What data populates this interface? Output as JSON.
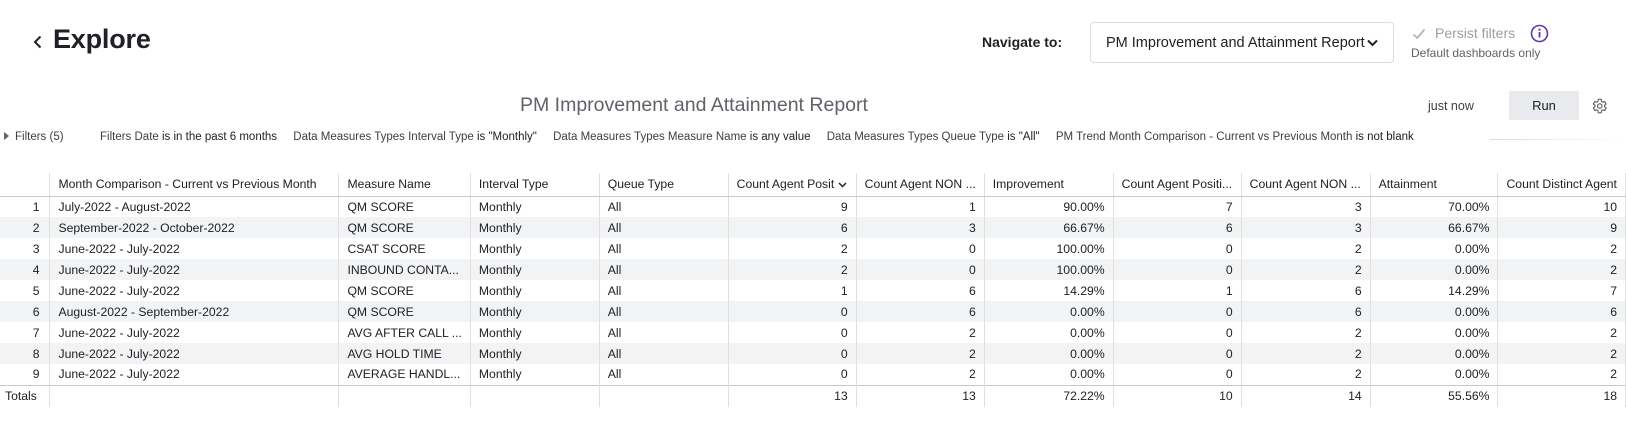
{
  "header": {
    "title": "Explore",
    "navigate_label": "Navigate to:",
    "navigate_value": "PM Improvement and Attainment Report",
    "persist_label": "Persist filters",
    "persist_sub": "Default dashboards only"
  },
  "report": {
    "title": "PM Improvement and Attainment Report",
    "last_run": "just now",
    "run_label": "Run"
  },
  "filters": {
    "toggle_label": "Filters (5)",
    "items": [
      {
        "prefix": "Filters Date",
        "op": " is in the past 6 months"
      },
      {
        "prefix": "Data Measures Types Interval Type",
        "op": " is \"Monthly\""
      },
      {
        "prefix": "Data Measures Types Measure Name",
        "op": " is any value"
      },
      {
        "prefix": "Data Measures Types Queue Type",
        "op": " is \"All\""
      },
      {
        "prefix": "PM Trend Month Comparison - Current vs Previous Month",
        "op": " is not blank"
      }
    ]
  },
  "table": {
    "headers": [
      "",
      "Month Comparison - Current vs Previous Month",
      "Measure Name",
      "Interval Type",
      "Queue Type",
      "Count Agent Posit",
      "Count Agent NON ...",
      "Improvement",
      "Count Agent Positi...",
      "Count Agent NON ...",
      "Attainment",
      "Count Distinct Agent"
    ],
    "rows": [
      [
        "1",
        "July-2022 - August-2022",
        "QM SCORE",
        "Monthly",
        "All",
        "9",
        "1",
        "90.00%",
        "7",
        "3",
        "70.00%",
        "10"
      ],
      [
        "2",
        "September-2022 - October-2022",
        "QM SCORE",
        "Monthly",
        "All",
        "6",
        "3",
        "66.67%",
        "6",
        "3",
        "66.67%",
        "9"
      ],
      [
        "3",
        "June-2022 - July-2022",
        "CSAT SCORE",
        "Monthly",
        "All",
        "2",
        "0",
        "100.00%",
        "0",
        "2",
        "0.00%",
        "2"
      ],
      [
        "4",
        "June-2022 - July-2022",
        "INBOUND CONTA...",
        "Monthly",
        "All",
        "2",
        "0",
        "100.00%",
        "0",
        "2",
        "0.00%",
        "2"
      ],
      [
        "5",
        "June-2022 - July-2022",
        "QM SCORE",
        "Monthly",
        "All",
        "1",
        "6",
        "14.29%",
        "1",
        "6",
        "14.29%",
        "7"
      ],
      [
        "6",
        "August-2022 - September-2022",
        "QM SCORE",
        "Monthly",
        "All",
        "0",
        "6",
        "0.00%",
        "0",
        "6",
        "0.00%",
        "6"
      ],
      [
        "7",
        "June-2022 - July-2022",
        "AVG AFTER CALL ...",
        "Monthly",
        "All",
        "0",
        "2",
        "0.00%",
        "0",
        "2",
        "0.00%",
        "2"
      ],
      [
        "8",
        "June-2022 - July-2022",
        "AVG HOLD TIME",
        "Monthly",
        "All",
        "0",
        "2",
        "0.00%",
        "0",
        "2",
        "0.00%",
        "2"
      ],
      [
        "9",
        "June-2022 - July-2022",
        "AVERAGE HANDL...",
        "Monthly",
        "All",
        "0",
        "2",
        "0.00%",
        "0",
        "2",
        "0.00%",
        "2"
      ]
    ],
    "totals": [
      "Totals",
      "",
      "",
      "",
      "",
      "13",
      "13",
      "72.22%",
      "10",
      "14",
      "55.56%",
      "18"
    ]
  },
  "colors": {
    "accent": "#5e35b1",
    "stripe": "#f1f3f4"
  }
}
